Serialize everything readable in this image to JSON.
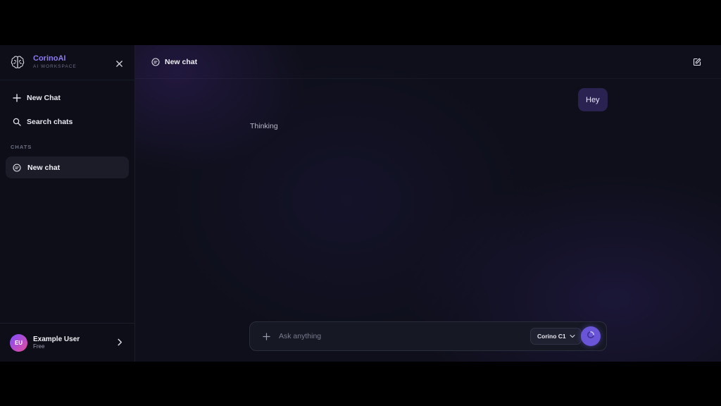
{
  "brand": {
    "name": "CorinoAI",
    "subtitle": "AI WORKSPACE"
  },
  "sidebar": {
    "nav": [
      {
        "label": "New Chat",
        "icon": "plus-icon"
      },
      {
        "label": "Search chats",
        "icon": "search-icon"
      }
    ],
    "section_label": "CHATS",
    "chats": [
      {
        "label": "New chat",
        "icon": "chat-bubble-icon",
        "active": true
      }
    ]
  },
  "user": {
    "initials": "EU",
    "name": "Example User",
    "plan": "Free"
  },
  "header": {
    "title": "New chat"
  },
  "conversation": {
    "user_message": "Hey",
    "assistant_status": "Thinking"
  },
  "composer": {
    "placeholder": "Ask anything",
    "model": "Corino C1"
  },
  "colors": {
    "accent": "#6a55d8",
    "brand_text": "#8b7bf0",
    "user_bubble": "#2a2352",
    "sidebar_bg": "#0d0e17"
  }
}
